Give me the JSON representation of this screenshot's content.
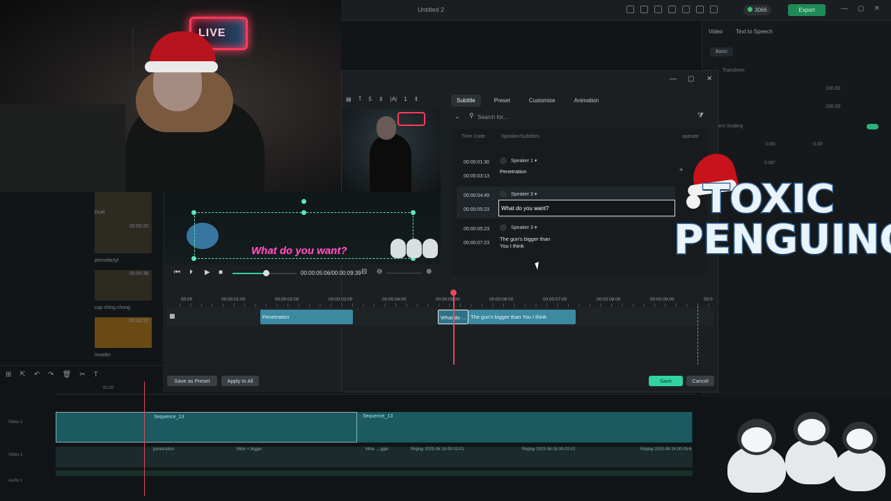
{
  "window": {
    "title": "Untitled 2",
    "export_label": "Export",
    "credits": "3066",
    "win_controls": [
      "—",
      "▢",
      "✕"
    ]
  },
  "right_panel": {
    "tabs": [
      "Video",
      "Text to Speech"
    ],
    "section": "Basic",
    "transform_label": "Transform",
    "storm_scaling": "orm Scaling",
    "value_100": "100.00",
    "pos_x": "0.00",
    "pos_y": "0.00",
    "rotate": "0.00°"
  },
  "media_bin": {
    "items": [
      {
        "label": "Duel"
      },
      {
        "label": "pterodactyl",
        "duration": "00:00:20"
      },
      {
        "label": "cap ching chong",
        "duration": "00:00:38"
      },
      {
        "label": "invader",
        "duration": "00:00:20"
      }
    ]
  },
  "main_timeline": {
    "track_labels": [
      "Video 2",
      "Video 1",
      "Audio 1"
    ],
    "sequence_label": "Sequence_13",
    "sequence_label_2": "Sequence_13",
    "v1_clips": [
      "penetration",
      "Mine + bigger",
      "Mine ... gger",
      "Replay 2025-06-16 00-02-01",
      "Replay 2025-06-16 00-02-01",
      "Replay 2025-06-16 00-05-6"
    ],
    "ruler_mark": "00:25"
  },
  "subtitle_dialog": {
    "toolbar": {
      "size_value": "5",
      "spacing_value": "1"
    },
    "tabs": [
      {
        "label": "Subtitle",
        "active": true
      },
      {
        "label": "Preset",
        "active": false
      },
      {
        "label": "Customize",
        "active": false
      },
      {
        "label": "Animation",
        "active": false
      }
    ],
    "search": {
      "placeholder": "Search for..."
    },
    "columns": {
      "time_code": "Time Code",
      "speaker": "Speaker/Subtitles",
      "operate": "operate"
    },
    "rows": [
      {
        "start": "00:00:01:30",
        "end": "00:00:03:13",
        "speaker": "Speaker 1",
        "text": "Penetration"
      },
      {
        "start": "00:00:04:49",
        "end": "00:00:05:23",
        "speaker": "Speaker 3",
        "text": "What do you want?"
      },
      {
        "start": "00:00:05:23",
        "end": "00:00:07:23",
        "speaker": "Speaker 3",
        "text_line1": "The gun's bigger than",
        "text_line2": "You I think"
      }
    ],
    "preview": {
      "overlay_subtitle": "What do you want?",
      "timecode": "00:00:05:06/00:00:09:39"
    },
    "timeline": {
      "ticks": [
        "00:00",
        "00:00:01:00",
        "00:00:02:00",
        "00:00:03:00",
        "00:00:04:00",
        "00:00:05:00",
        "00:00:06:00",
        "00:00:07:00",
        "00:00:08:00",
        "00:00:09:00",
        "00:0"
      ],
      "clips": [
        {
          "label": "Penetration"
        },
        {
          "label": "What do ..."
        },
        {
          "label": "The gun's bigger than You I think"
        }
      ]
    },
    "buttons": {
      "save_as_preset": "Save as Preset",
      "apply_to_all": "Apply to All",
      "save": "Save",
      "cancel": "Cancel"
    }
  },
  "overlay": {
    "logo_line1": "TOXIC",
    "logo_line2": "PENGUINO",
    "neon_text": "LIVE"
  }
}
